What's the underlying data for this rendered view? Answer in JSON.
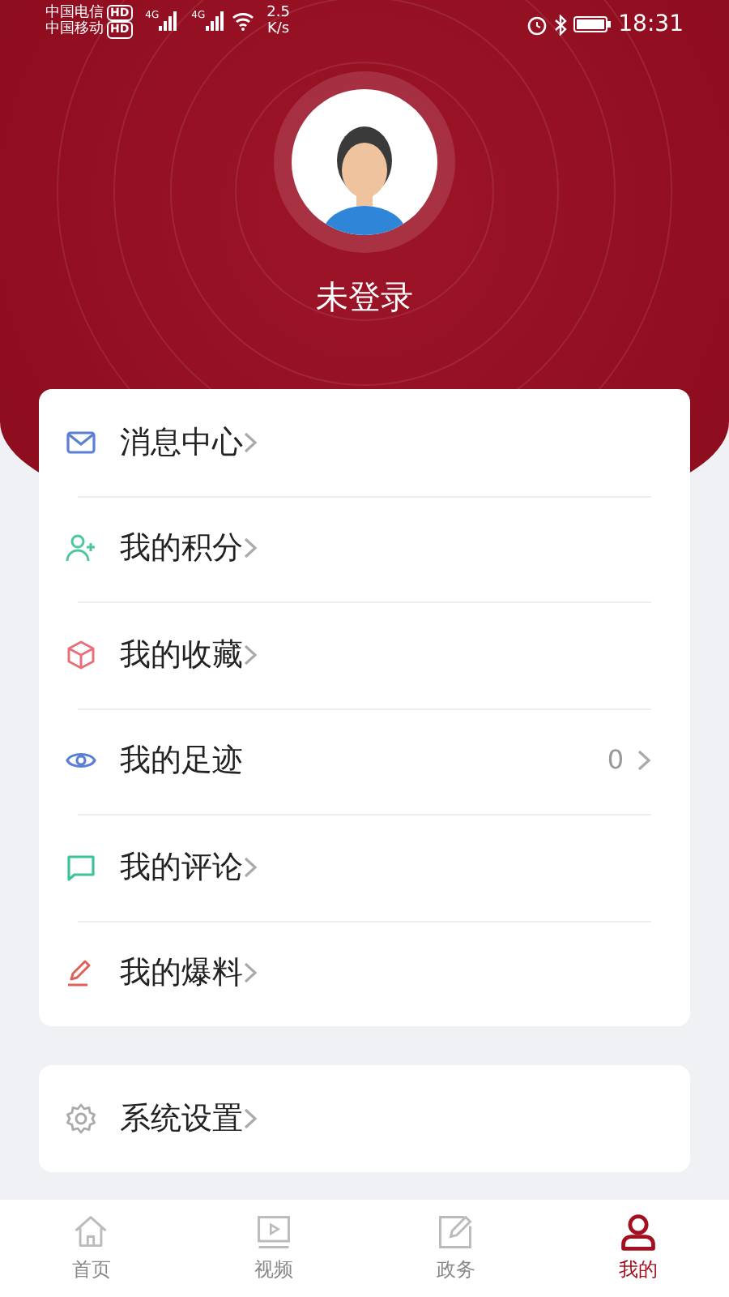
{
  "status_bar": {
    "carriers": [
      {
        "name": "中国电信",
        "badge": "HD"
      },
      {
        "name": "中国移动",
        "badge": "HD"
      }
    ],
    "network_labels": [
      "4G",
      "4G"
    ],
    "speed": "2.5",
    "speed_unit": "K/s",
    "time": "18:31"
  },
  "profile": {
    "name": "未登录"
  },
  "menu": [
    {
      "kind": "mail",
      "label": "消息中心"
    },
    {
      "kind": "points",
      "label": "我的积分"
    },
    {
      "kind": "favorites",
      "label": "我的收藏"
    },
    {
      "kind": "history",
      "label": "我的足迹",
      "count": "0"
    },
    {
      "kind": "comments",
      "label": "我的评论"
    },
    {
      "kind": "reports",
      "label": "我的爆料"
    }
  ],
  "settings": [
    {
      "kind": "settings",
      "label": "系统设置"
    }
  ],
  "bottom_nav": [
    {
      "kind": "home",
      "label": "首页",
      "selected": false
    },
    {
      "kind": "video",
      "label": "视频",
      "selected": false
    },
    {
      "kind": "affairs",
      "label": "政务",
      "selected": false
    },
    {
      "kind": "me",
      "label": "我的",
      "selected": true
    }
  ]
}
